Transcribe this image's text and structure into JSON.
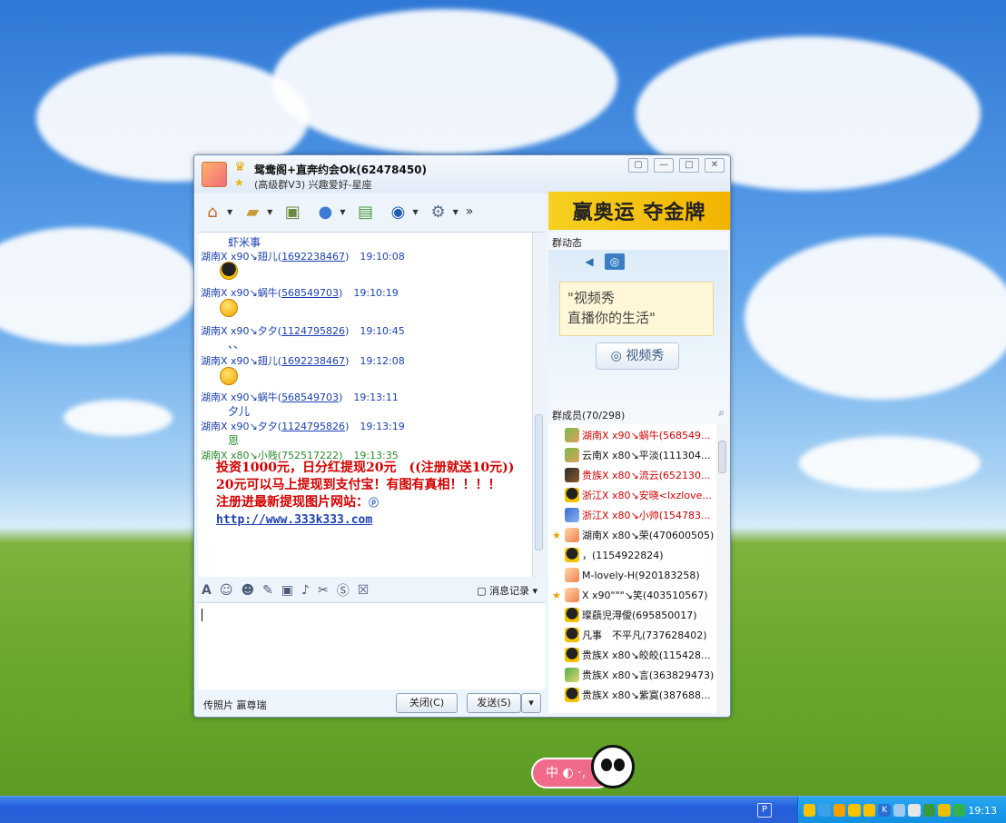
{
  "window": {
    "group_name": "鸳鸯阁+直奔约会Ok(62478450)",
    "group_sub": "(高级群V3) 兴趣爱好-星座",
    "banner": "赢奥运 夺金牌"
  },
  "chat": {
    "messages": [
      {
        "text": "虾米事"
      },
      {
        "sender": "湖南X x90↘翅儿",
        "qq": "1692238467",
        "time": "19:10:08"
      },
      {
        "sender": "湖南X x90↘蜗牛",
        "qq": "568549703",
        "time": "19:10:19"
      },
      {
        "sender": "湖南X x90↘夕夕",
        "qq": "1124795826",
        "time": "19:10:45"
      },
      {
        "text": "、、"
      },
      {
        "sender": "湖南X x90↘翅儿",
        "qq": "1692238467",
        "time": "19:12:08"
      },
      {
        "sender": "湖南X x90↘蜗牛",
        "qq": "568549703",
        "time": "19:13:11"
      },
      {
        "text": "夕儿"
      },
      {
        "sender": "湖南X x90↘夕夕",
        "qq": "1124795826",
        "time": "19:13:19"
      },
      {
        "text": "恩"
      },
      {
        "sender": "湖南X x80↘小贱",
        "qq": "752517222",
        "time": "19:13:35"
      }
    ],
    "spam_line1": "投资1000元，日分红提现20元　((注册就送10元))　20元可以马上提现到支付宝！有图有真相！！！！",
    "spam_line2": "注册进最新提现图片网站：",
    "spam_link": "http://www.333k333.com"
  },
  "input": {
    "msg_log": "消息记录",
    "footer_label": "传照片 赢尊瑞",
    "close_label": "关闭(C)",
    "send_label": "发送(S)"
  },
  "right": {
    "dynamic_title": "群动态",
    "video_note_line1": "\"视频秀",
    "video_note_line2": "直播你的生活\"",
    "video_btn": "视频秀",
    "members_title": "群成员(70/298)",
    "members": [
      {
        "name": "湖南X x90↘蜗牛(568549...",
        "color": "red",
        "star": false,
        "av": "admin"
      },
      {
        "name": "云南X x80↘平淡(111304...",
        "color": "blk",
        "star": false,
        "av": "admin"
      },
      {
        "name": "贵族X x80↘流云(652130...",
        "color": "red",
        "star": false,
        "av": "dark"
      },
      {
        "name": "浙江X x80↘安晓<lxzlove...",
        "color": "red",
        "star": false,
        "av": "qq"
      },
      {
        "name": "浙江X x80↘小帅(154783...",
        "color": "red",
        "star": false,
        "av": "blue"
      },
      {
        "name": "湖南X x80↘荣(470600505)",
        "color": "blk",
        "star": true,
        "av": "face"
      },
      {
        "name": "，(1154922824)",
        "color": "blk",
        "star": false,
        "av": "qq"
      },
      {
        "name": "M-lovely-H(920183258)",
        "color": "blk",
        "star": false,
        "av": "face"
      },
      {
        "name": "X x90\"\"\"↘笑(403510567)",
        "color": "blk",
        "star": true,
        "av": "face"
      },
      {
        "name": "璨蕻児淂僾(695850017)",
        "color": "blk",
        "star": false,
        "av": "qq"
      },
      {
        "name": "凡事　不平凡(737628402)",
        "color": "blk",
        "star": false,
        "av": "qq"
      },
      {
        "name": "贵族X x80↘皎皎(115428...",
        "color": "blk",
        "star": false,
        "av": "qq"
      },
      {
        "name": "贵族X x80↘言(363829473)",
        "color": "blk",
        "star": false,
        "av": "green"
      },
      {
        "name": "贵族X x80↘紫寞(387688...",
        "color": "blk",
        "star": false,
        "av": "qq"
      }
    ]
  },
  "ime": {
    "label": "中"
  },
  "taskbar": {
    "clock": "19:13"
  }
}
